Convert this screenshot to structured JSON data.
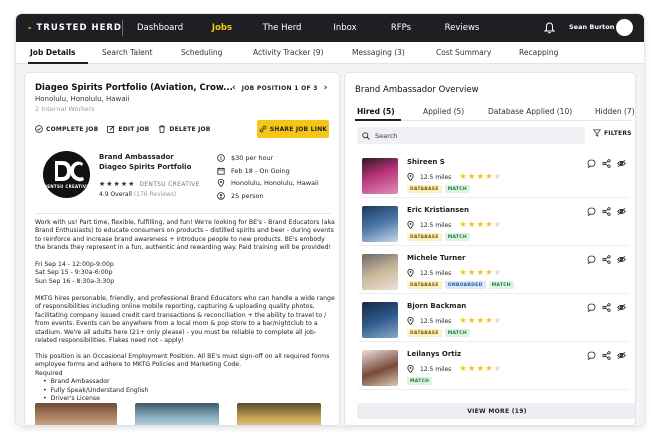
{
  "brand": {
    "name": "TRUSTED HERD"
  },
  "nav": {
    "items": [
      {
        "label": "Dashboard",
        "active": false
      },
      {
        "label": "Jobs",
        "active": true
      },
      {
        "label": "The Herd",
        "active": false
      },
      {
        "label": "Inbox",
        "active": false
      },
      {
        "label": "RFPs",
        "active": false
      },
      {
        "label": "Reviews",
        "active": false
      }
    ],
    "user_name": "Sean Burton"
  },
  "tabs": [
    {
      "label": "Job Details",
      "active": true
    },
    {
      "label": "Search Talent",
      "active": false
    },
    {
      "label": "Scheduling",
      "active": false
    },
    {
      "label": "Activity Tracker  (9)",
      "active": false
    },
    {
      "label": "Messaging  (3)",
      "active": false
    },
    {
      "label": "Cost Summary",
      "active": false
    },
    {
      "label": "Recapping",
      "active": false
    }
  ],
  "job": {
    "title": "Diageo Spirits Portfolio (Aviation, Crow...",
    "location": "Honolulu, Honolulu, Hawaii",
    "workers": "2 Internal Workers",
    "pager_label": "JOB POSITION 1 OF 3",
    "actions": {
      "complete": "COMPLETE JOB",
      "edit": "EDIT JOB",
      "delete": "DELETE JOB"
    },
    "share_label": "SHARE JOB LINK",
    "logo_text": "DENTSU CREATIVE",
    "role": "Brand Ambassador",
    "company": "Diageo Spirits Portfolio",
    "company_upper": "DENTSU CREATIVE",
    "stars": "★★★★★",
    "overall": "4.9 Overall",
    "reviews": "(176 Reviews)",
    "info": {
      "rate": "$30 per hour",
      "date": "Feb 18 - On Going",
      "place": "Honolulu, Honolulu, Hawaii",
      "people": "25 person"
    },
    "desc_intro": "Work with us! Part time, flexible, fulfilling, and fun! We're looking for BE's - Brand Educators (aka Brand Enthusiasts) to educate consumers on products – distilled spirits and beer - during events to reinforce and increase brand awareness + introduce people to new products. BE's embody the brands they represent in a fun, authentic and rewarding way. Paid training will be provided!",
    "schedule": [
      "Fri Sep 14 - 12:00p-9:00p",
      "Sat Sep 15 - 9:30a-6:00p",
      "Sun Sep 16 - 8:30a-3:30p"
    ],
    "desc_body": "MKTG hires personable, friendly, and professional Brand Educators who can handle a wide range of responsibilities including online mobile reporting, capturing & uploading quality photos, facilitating company issued credit card transactions & reconciliation + the ability to travel to / from events. Events can be anywhere from a local mom & pop store to a bar/nightclub to a stadium. We're all adults here (21+ only please) - you must be reliable to complete all job-related responsibilities. Flakes need not - apply!",
    "desc_note": "This position is an Occasional Employment Position. All BE's must sign-off on all required forms employee forms and adhere to MKTG Policies and Marketing Code.",
    "required_label": "Required",
    "required": [
      "Brand Ambassador",
      "Fully Speak/Understand English",
      "Driver's License"
    ]
  },
  "overview": {
    "title": "Brand Ambassador Overview",
    "tabs": [
      {
        "label": "Hired (5)",
        "active": true
      },
      {
        "label": "Applied (5)",
        "active": false
      },
      {
        "label": "Database Applied (10)",
        "active": false
      },
      {
        "label": "Hidden (7)",
        "active": false
      }
    ],
    "search_placeholder": "Search",
    "filters_label": "FILTERS",
    "candidates": [
      {
        "name": "Shireen S",
        "distance": "12.5 miles",
        "rating": 4,
        "badges": [
          "DATABASE",
          "MATCH"
        ]
      },
      {
        "name": "Eric Kristiansen",
        "distance": "12.5 miles",
        "rating": 4,
        "badges": [
          "DATABASE",
          "MATCH"
        ]
      },
      {
        "name": "Michele Turner",
        "distance": "12.5 miles",
        "rating": 4,
        "badges": [
          "DATABASE",
          "ONBOARDED",
          "MATCH"
        ]
      },
      {
        "name": "Bjorn Backman",
        "distance": "12.5 miles",
        "rating": 4,
        "badges": [
          "DATABASE",
          "MATCH"
        ]
      },
      {
        "name": "Leilanys Ortiz",
        "distance": "12.5 miles",
        "rating": 4,
        "badges": [
          "MATCH"
        ]
      }
    ],
    "view_more": "VIEW MORE  (19)"
  },
  "colors": {
    "accent": "#f5c518",
    "nav_bg": "#1e1f22"
  }
}
